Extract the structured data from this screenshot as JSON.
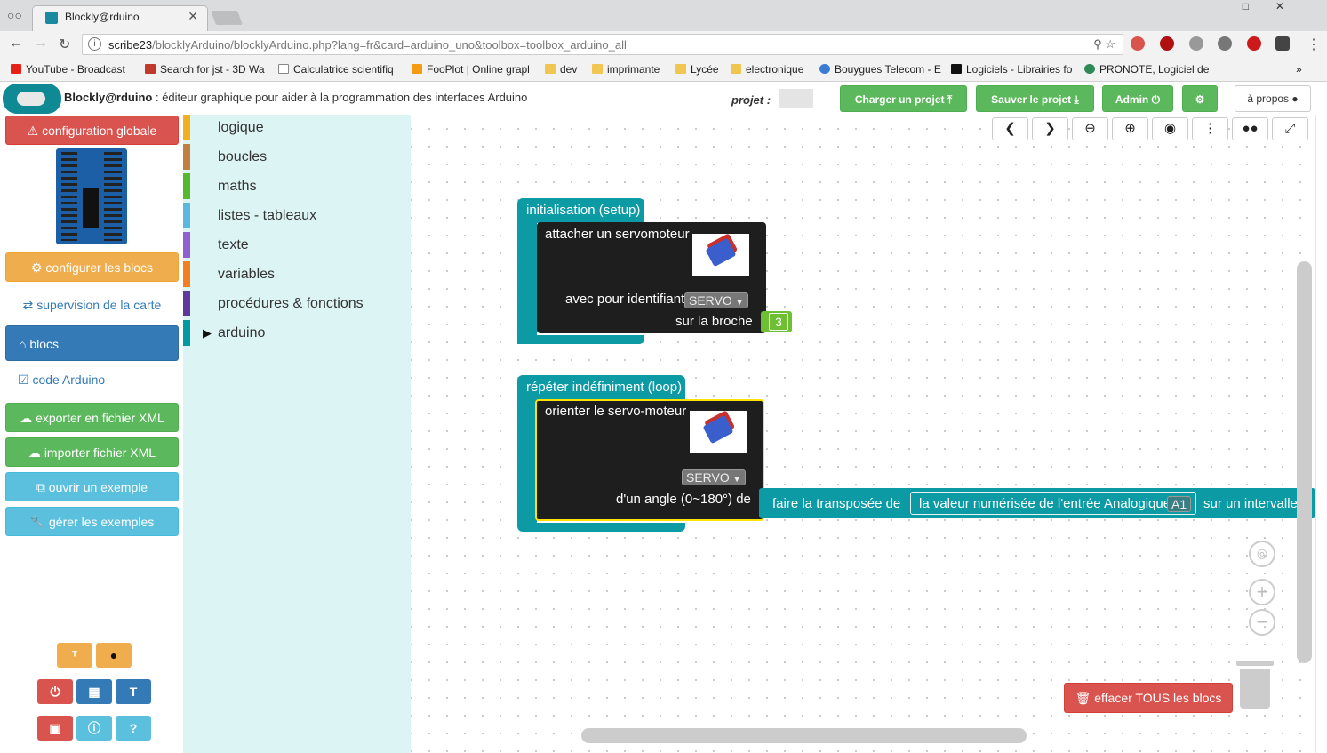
{
  "browser": {
    "tab_title": "Blockly@rduino",
    "url_host": "scribe23",
    "url_path": "/blocklyArduino/blocklyArduino.php?lang=fr&card=arduino_uno&toolbox=toolbox_arduino_all",
    "bookmarks": [
      "YouTube - Broadcast",
      "Search for jst - 3D Wa",
      "Calculatrice scientifiq",
      "FooPlot | Online grapl",
      "dev",
      "imprimante",
      "Lycée",
      "electronique",
      "Bouygues Telecom - E",
      "Logiciels - Librairies fo",
      "PRONOTE, Logiciel de"
    ]
  },
  "header": {
    "app_name": "Blockly@rduino",
    "subtitle": " : éditeur graphique pour aider à la programmation des interfaces Arduino",
    "projet_label": "projet :",
    "load_label": "Charger un projet",
    "save_label": "Sauver le projet",
    "admin_label": "Admin",
    "about_label": "à propos"
  },
  "sidebar": {
    "global_config": "configuration globale",
    "configure_blocks": "configurer les blocs",
    "supervision": "supervision de la carte",
    "blocks": "blocs",
    "arduino_code": "code Arduino",
    "export_xml": "exporter en fichier XML",
    "import_xml": "importer fichier XML",
    "open_example": "ouvrir un exemple",
    "manage_examples": "gérer les exemples"
  },
  "toolbox": {
    "categories": [
      {
        "label": "logique",
        "color": "#f0b020"
      },
      {
        "label": "boucles",
        "color": "#c08040"
      },
      {
        "label": "maths",
        "color": "#58b82c"
      },
      {
        "label": "listes - tableaux",
        "color": "#5ab8e0"
      },
      {
        "label": "texte",
        "color": "#9060d0"
      },
      {
        "label": "variables",
        "color": "#f08020"
      },
      {
        "label": "procédures & fonctions",
        "color": "#6038a0"
      },
      {
        "label": "arduino",
        "color": "#009aa0"
      }
    ]
  },
  "workspace": {
    "setup_label": "initialisation (setup)",
    "attach_servo": "attacher un servomoteur",
    "with_id": "avec pour identifiant",
    "servo_dd": "SERVO",
    "on_pin": "sur la broche",
    "pin_value": "3",
    "loop_label": "répéter indéfiniment (loop)",
    "orient_servo": "orienter le servo-moteur",
    "angle_label": "d'un angle (0~180°) de",
    "transpose_label": "faire la transposée de",
    "analog_label": "la valeur numérisée de l'entrée Analogique",
    "analog_pin": "A1",
    "interval_label": "sur un intervalle",
    "clear_all": "effacer TOUS les blocs"
  }
}
